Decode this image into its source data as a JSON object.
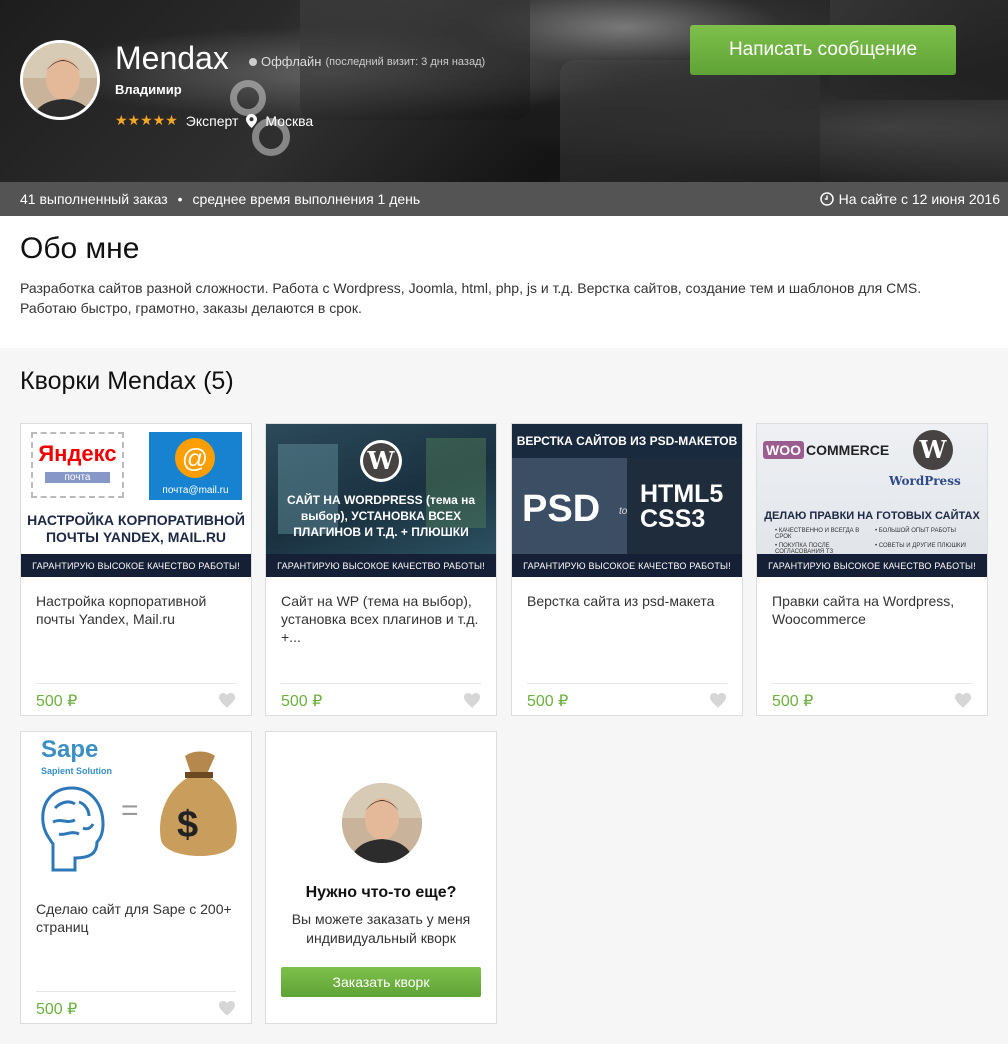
{
  "header": {
    "name": "Mendax",
    "status": "Оффлайн",
    "last_visit": "(последний визит: 3 дня назад)",
    "first_name": "Владимир",
    "stars": "★★★★★",
    "level": "Эксперт",
    "city": "Москва",
    "message_button": "Написать сообщение"
  },
  "stats": {
    "orders": "41 выполненный заказ",
    "separator": "•",
    "avg_time": "среднее время выполнения 1 день",
    "since": "На сайте с 12 июня 2016"
  },
  "about": {
    "title": "Обо мне",
    "text_line1": "Разработка сайтов разной сложности. Работа с Wordpress, Joomla, html, php, js и т.д. Верстка сайтов, создание тем и шаблонов для CMS.",
    "text_line2": "Работаю быстро, грамотно, заказы делаются в срок."
  },
  "kworks": {
    "heading": "Кворки Mendax (5)",
    "items": [
      {
        "title": "Настройка корпоративной почты Yandex, Mail.ru",
        "price": "500 ₽",
        "banner": {
          "yandex": "Яндекс",
          "yandex_sub": "почта",
          "mail_sub": "почта@mail.ru",
          "headline": "НАСТРОЙКА КОРПОРАТИВНОЙ ПОЧТЫ YANDEX, MAIL.RU",
          "strip": "ГАРАНТИРУЮ ВЫСОКОЕ КАЧЕСТВО РАБОТЫ!"
        }
      },
      {
        "title": "Сайт на WP (тема на выбор), установка всех плагинов и т.д. +...",
        "price": "500 ₽",
        "banner": {
          "headline": "САЙТ НА WORDPRESS (тема на выбор), УСТАНОВКА ВСЕХ ПЛАГИНОВ И Т.Д. + ПЛЮШКИ",
          "strip": "ГАРАНТИРУЮ ВЫСОКОЕ КАЧЕСТВО РАБОТЫ!"
        }
      },
      {
        "title": "Верстка сайта из psd-макета",
        "price": "500 ₽",
        "banner": {
          "top": "ВЕРСТКА САЙТОВ ИЗ PSD-МАКЕТОВ",
          "psd": "PSD",
          "to": "to",
          "html": "HTML5",
          "css": "CSS3",
          "strip": "ГАРАНТИРУЮ ВЫСОКОЕ КАЧЕСТВО РАБОТЫ!"
        }
      },
      {
        "title": "Правки сайта на Wordpress, Woocommerce",
        "price": "500 ₽",
        "banner": {
          "woo": "WOO",
          "commerce": "COMMERCE",
          "wp": "WordPress",
          "headline": "ДЕЛАЮ ПРАВКИ НА ГОТОВЫХ САЙТАХ",
          "bullets": [
            "• КАЧЕСТВЕННО И ВСЕГДА В СРОК",
            "• БОЛЬШОЙ ОПЫТ РАБОТЫ",
            "• ПОКУПКА ПОСЛЕ СОГЛАСОВАНИЯ ТЗ",
            "• СОВЕТЫ И ДРУГИЕ ПЛЮШКИ!"
          ],
          "strip": "ГАРАНТИРУЮ ВЫСОКОЕ КАЧЕСТВО РАБОТЫ!"
        }
      },
      {
        "title": "Сделаю сайт для Sape с 200+ страниц",
        "price": "500 ₽",
        "banner": {
          "sape": "Sape",
          "sape_sub": "Sapient Solution",
          "eq": "=",
          "dollar": "$"
        }
      }
    ]
  },
  "more": {
    "question": "Нужно что-то еще?",
    "desc": "Вы можете заказать у меня индивидуальный кворк",
    "button": "Заказать кворк"
  },
  "colors": {
    "accent_green": "#6cb03f",
    "stats_bar": "#545454",
    "strip_navy": "#151f35"
  }
}
